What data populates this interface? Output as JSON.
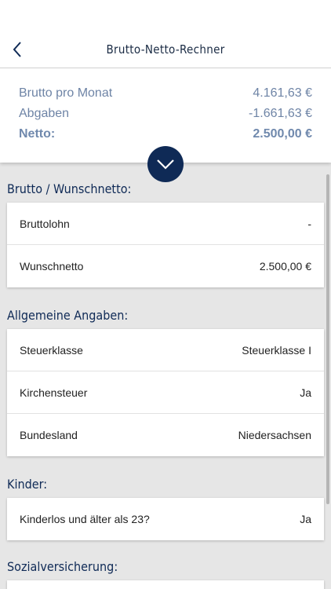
{
  "header": {
    "title": "Brutto-Netto-Rechner"
  },
  "summary": {
    "rows": [
      {
        "label": "Brutto pro Monat",
        "value": "4.161,63 €"
      },
      {
        "label": "Abgaben",
        "value": "-1.661,63 €"
      },
      {
        "label": "Netto:",
        "value": "2.500,00 €"
      }
    ]
  },
  "sections": [
    {
      "title": "Brutto / Wunschnetto:",
      "rows": [
        {
          "label": "Bruttolohn",
          "value": "-"
        },
        {
          "label": "Wunschnetto",
          "value": "2.500,00 €"
        }
      ]
    },
    {
      "title": "Allgemeine Angaben:",
      "rows": [
        {
          "label": "Steuerklasse",
          "value": "Steuerklasse I"
        },
        {
          "label": "Kirchensteuer",
          "value": "Ja"
        },
        {
          "label": "Bundesland",
          "value": "Niedersachsen"
        }
      ]
    },
    {
      "title": "Kinder:",
      "rows": [
        {
          "label": "Kinderlos und älter als 23?",
          "value": "Ja"
        }
      ]
    },
    {
      "title": "Sozialversicherung:",
      "rows": []
    }
  ],
  "colors": {
    "primary": "#0f2a56",
    "summary_text": "#6e84a6",
    "background": "#e6e6e6"
  },
  "icons": {
    "back": "chevron-left-icon",
    "toggle": "chevron-down-icon"
  }
}
